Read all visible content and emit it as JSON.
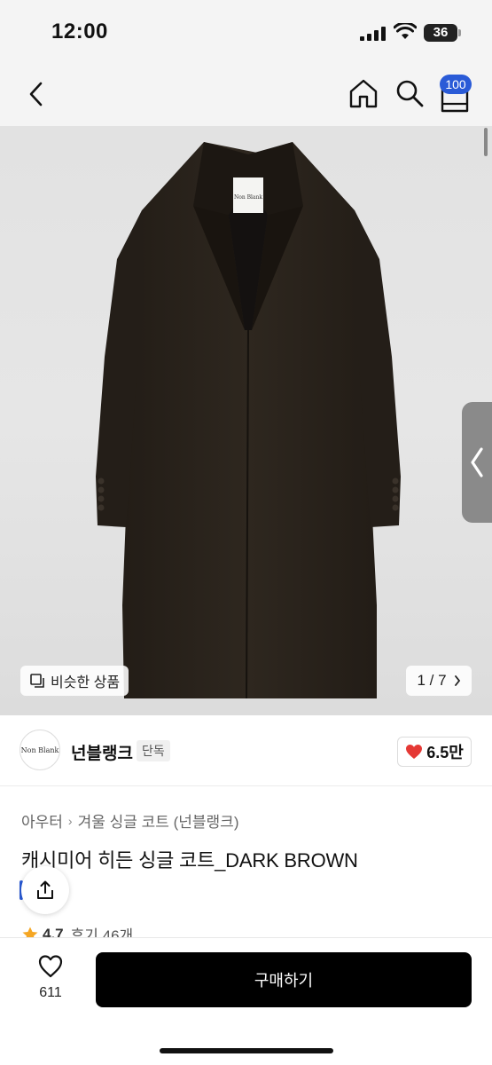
{
  "status_bar": {
    "time": "12:00",
    "battery": "36"
  },
  "nav": {
    "cart_count": "100"
  },
  "hero": {
    "similar_label": "비슷한 상품",
    "page_indicator": "1 / 7",
    "tag_text": "Non Blank",
    "coat_color": "#2b241d",
    "background": "#e3e3e3"
  },
  "brand": {
    "logo_text": "Non Blank",
    "name": "넌블랭크",
    "tag": "단독",
    "likes": "6.5만"
  },
  "product": {
    "breadcrumb": [
      "아우터",
      "겨울 싱글 코트 (넌블랭크)"
    ],
    "title": "캐시미어 히든 싱글 코트_DARK BROWN",
    "rating": "4.7",
    "reviews": "후기 46개"
  },
  "bottom": {
    "wish_count": "611",
    "buy_label": "구매하기"
  },
  "colors": {
    "accent": "#2a5bd7",
    "heart": "#e53935",
    "star": "#f5a623",
    "buy": "#000000"
  }
}
